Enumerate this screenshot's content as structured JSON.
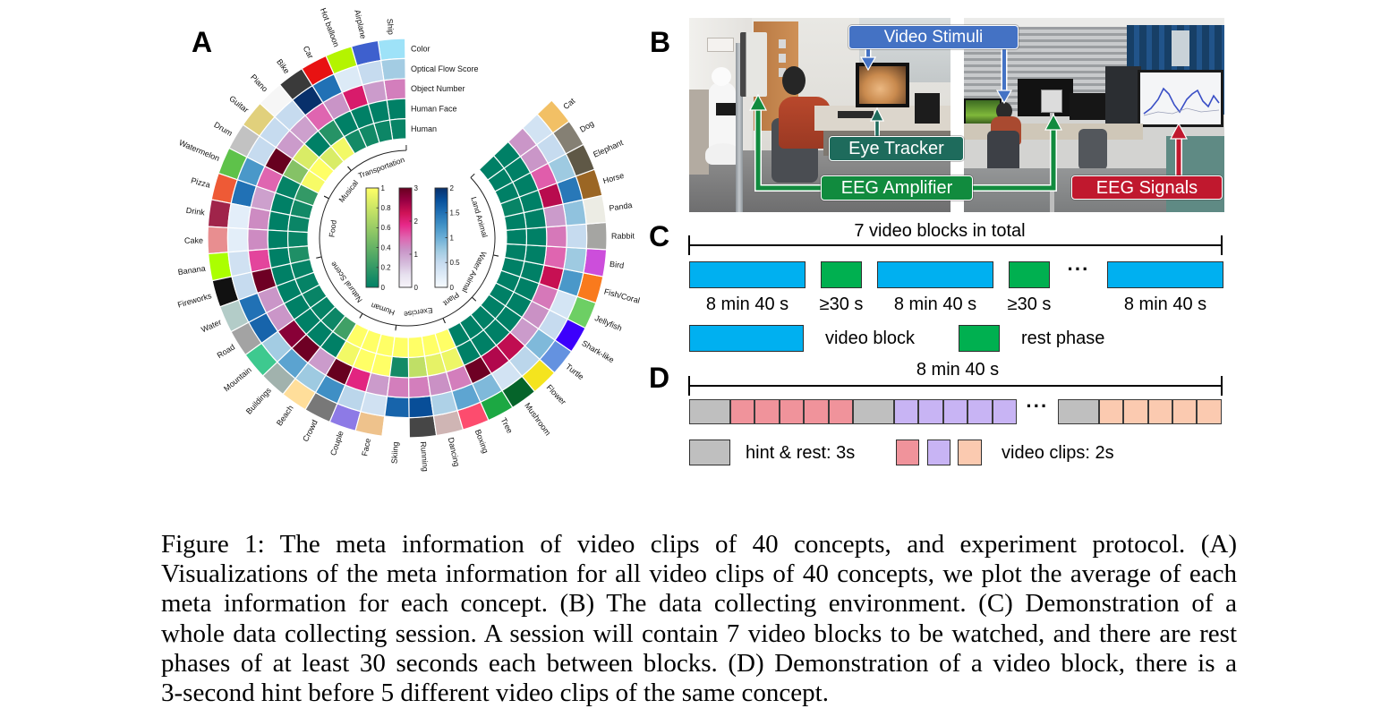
{
  "panel_labels": {
    "a": "A",
    "b": "B",
    "c": "C",
    "d": "D"
  },
  "chart_data": {
    "type": "heatmap",
    "layout": "circular",
    "title": "",
    "legend": "top-right",
    "rings": [
      {
        "key": "color",
        "label": "Color"
      },
      {
        "key": "optical_flow",
        "label": "Optical Flow Score",
        "colorbar": "blues"
      },
      {
        "key": "object_number",
        "label": "Object Number",
        "colorbar": "purd"
      },
      {
        "key": "human_face",
        "label": "Human Face",
        "colorbar": "summer"
      },
      {
        "key": "human",
        "label": "Human",
        "colorbar": "summer"
      }
    ],
    "categories": [
      "Transportation",
      "Musical",
      "Food",
      "Natural Scene",
      "Human",
      "Exercise",
      "Plant",
      "Water Animal",
      "Land Animal"
    ],
    "concepts": [
      {
        "name": "Ship",
        "category": "Transportation",
        "color": "#9ee2f8",
        "optical_flow": 0.72,
        "object_number": 1.3,
        "human_face": 0,
        "human": 0.03
      },
      {
        "name": "Airplane",
        "category": "Transportation",
        "color": "#3e60ce",
        "optical_flow": 0.5,
        "object_number": 1.05,
        "human_face": 0,
        "human": 0.05
      },
      {
        "name": "Hot balloon",
        "category": "Transportation",
        "color": "#b4f400",
        "optical_flow": 0.27,
        "object_number": 2.1,
        "human_face": 0,
        "human": 0.07
      },
      {
        "name": "Car",
        "category": "Transportation",
        "color": "#e81212",
        "optical_flow": 1.5,
        "object_number": 1.12,
        "human_face": 0,
        "human": 0.08
      },
      {
        "name": "Bike",
        "category": "Transportation",
        "color": "#3a3a3a",
        "optical_flow": 2.0,
        "object_number": 1.5,
        "human_face": 0.15,
        "human": 0.95
      },
      {
        "name": "Piano",
        "category": "Musical",
        "color": "#f6f6f6",
        "optical_flow": 0.5,
        "object_number": 1.0,
        "human_face": 0,
        "human": 0.85
      },
      {
        "name": "Guitar",
        "category": "Musical",
        "color": "#e1d07c",
        "optical_flow": 0.5,
        "object_number": 1.05,
        "human_face": 0.85,
        "human": 1.0
      },
      {
        "name": "Drum",
        "category": "Musical",
        "color": "#c2c2c2",
        "optical_flow": 0.5,
        "object_number": 3.0,
        "human_face": 0.52,
        "human": 0.97
      },
      {
        "name": "Watermelon",
        "category": "Food",
        "color": "#5ec24a",
        "optical_flow": 1.2,
        "object_number": 1.5,
        "human_face": 0.02,
        "human": 0.2
      },
      {
        "name": "Pizza",
        "category": "Food",
        "color": "#ee5a36",
        "optical_flow": 1.5,
        "object_number": 1.0,
        "human_face": 0,
        "human": 0.07
      },
      {
        "name": "Drink",
        "category": "Food",
        "color": "#a0244a",
        "optical_flow": 0.2,
        "object_number": 1.2,
        "human_face": 0,
        "human": 0.04
      },
      {
        "name": "Cake",
        "category": "Food",
        "color": "#e88e90",
        "optical_flow": 0.2,
        "object_number": 1.2,
        "human_face": 0,
        "human": 0.03
      },
      {
        "name": "Banana",
        "category": "Food",
        "color": "#abff00",
        "optical_flow": 0.4,
        "object_number": 1.7,
        "human_face": 0,
        "human": 0.12
      },
      {
        "name": "Fireworks",
        "category": "Natural Scene",
        "color": "#111111",
        "optical_flow": 0.5,
        "object_number": 2.95,
        "human_face": 0,
        "human": 0.02
      },
      {
        "name": "Water",
        "category": "Natural Scene",
        "color": "#b3ccc8",
        "optical_flow": 1.5,
        "object_number": 1.1,
        "human_face": 0,
        "human": 0.02
      },
      {
        "name": "Road",
        "category": "Natural Scene",
        "color": "#a3a3a3",
        "optical_flow": 1.6,
        "object_number": 1.1,
        "human_face": 0,
        "human": 0.03
      },
      {
        "name": "Mountain",
        "category": "Natural Scene",
        "color": "#3ec98f",
        "optical_flow": 0.72,
        "object_number": 2.75,
        "human_face": 0,
        "human": 0.02
      },
      {
        "name": "Buildings",
        "category": "Natural Scene",
        "color": "#a1b2ad",
        "optical_flow": 1.1,
        "object_number": 2.95,
        "human_face": 0,
        "human": 0.05
      },
      {
        "name": "Beach",
        "category": "Natural Scene",
        "color": "#ffde9a",
        "optical_flow": 0.75,
        "object_number": 1.05,
        "human_face": 0,
        "human": 0.25
      },
      {
        "name": "Crowd",
        "category": "Human",
        "color": "#787878",
        "optical_flow": 1.27,
        "object_number": 3.0,
        "human_face": 0.95,
        "human": 1.0
      },
      {
        "name": "Couple",
        "category": "Human",
        "color": "#8d7ae6",
        "optical_flow": 0.57,
        "object_number": 1.95,
        "human_face": 1.0,
        "human": 1.0
      },
      {
        "name": "Face",
        "category": "Human",
        "color": "#eec28c",
        "optical_flow": 0.4,
        "object_number": 1.05,
        "human_face": 1.0,
        "human": 1.0
      },
      {
        "name": "Skiing",
        "category": "Exercise",
        "color": "#ffffff",
        "optical_flow": 1.6,
        "object_number": 1.3,
        "human_face": 0.08,
        "human": 1.0
      },
      {
        "name": "Running",
        "category": "Exercise",
        "color": "#464646",
        "optical_flow": 1.77,
        "object_number": 1.3,
        "human_face": 0.75,
        "human": 1.0
      },
      {
        "name": "Dancing",
        "category": "Exercise",
        "color": "#cfb5b4",
        "optical_flow": 0.65,
        "object_number": 1.15,
        "human_face": 0.9,
        "human": 1.0
      },
      {
        "name": "Boxing",
        "category": "Exercise",
        "color": "#fd4c6e",
        "optical_flow": 1.08,
        "object_number": 1.3,
        "human_face": 0.93,
        "human": 1.0
      },
      {
        "name": "Tree",
        "category": "Plant",
        "color": "#1ca843",
        "optical_flow": 0.9,
        "object_number": 2.95,
        "human_face": 0,
        "human": 0
      },
      {
        "name": "Mushroom",
        "category": "Plant",
        "color": "#05642a",
        "optical_flow": 0.38,
        "object_number": 2.45,
        "human_face": 0,
        "human": 0
      },
      {
        "name": "Flower",
        "category": "Plant",
        "color": "#f4e41e",
        "optical_flow": 0.57,
        "object_number": 2.35,
        "human_face": 0,
        "human": 0
      },
      {
        "name": "Turtle",
        "category": "Water Animal",
        "color": "#6492e0",
        "optical_flow": 0.9,
        "object_number": 1.05,
        "human_face": 0,
        "human": 0
      },
      {
        "name": "Shark-like",
        "category": "Water Animal",
        "color": "#3c00fc",
        "optical_flow": 0.5,
        "object_number": 1.15,
        "human_face": 0,
        "human": 0
      },
      {
        "name": "Jellyfish",
        "category": "Water Animal",
        "color": "#6dcf64",
        "optical_flow": 0.35,
        "object_number": 1.35,
        "human_face": 0,
        "human": 0
      },
      {
        "name": "Fish/Coral",
        "category": "Water Animal",
        "color": "#f97a1d",
        "optical_flow": 1.2,
        "object_number": 2.3,
        "human_face": 0,
        "human": 0
      },
      {
        "name": "Bird",
        "category": "Land Animal",
        "color": "#cc4edb",
        "optical_flow": 0.75,
        "object_number": 1.5,
        "human_face": 0,
        "human": 0
      },
      {
        "name": "Rabbit",
        "category": "Land Animal",
        "color": "#a5a5a2",
        "optical_flow": 0.5,
        "object_number": 1.35,
        "human_face": 0,
        "human": 0
      },
      {
        "name": "Panda",
        "category": "Land Animal",
        "color": "#ecece4",
        "optical_flow": 0.82,
        "object_number": 1.05,
        "human_face": 0,
        "human": 0
      },
      {
        "name": "Horse",
        "category": "Land Animal",
        "color": "#9b6624",
        "optical_flow": 1.45,
        "object_number": 2.4,
        "human_face": 0,
        "human": 0.03
      },
      {
        "name": "Elephant",
        "category": "Land Animal",
        "color": "#5f5846",
        "optical_flow": 0.75,
        "object_number": 1.55,
        "human_face": 0,
        "human": 0
      },
      {
        "name": "Dog",
        "category": "Land Animal",
        "color": "#858074",
        "optical_flow": 0.5,
        "object_number": 1.1,
        "human_face": 0,
        "human": 0
      },
      {
        "name": "Cat",
        "category": "Land Animal",
        "color": "#f2c065",
        "optical_flow": 0.38,
        "object_number": 1.1,
        "human_face": 0,
        "human": 0
      }
    ],
    "colorbars": [
      {
        "id": "summer",
        "min": 0,
        "max": 1,
        "ticks": [
          "0",
          "0.2",
          "0.4",
          "0.6",
          "0.8",
          "1"
        ],
        "stops": [
          "#008066",
          "#ffff66"
        ]
      },
      {
        "id": "purd",
        "min": 0,
        "max": 3,
        "ticks": [
          "0",
          "1",
          "2",
          "3"
        ],
        "stops": [
          "#f7f4f9",
          "#e7e1ef",
          "#d4b9da",
          "#c994c7",
          "#df65b0",
          "#e7298a",
          "#ce1256",
          "#980043",
          "#67001f"
        ]
      },
      {
        "id": "blues",
        "min": 0,
        "max": 2,
        "ticks": [
          "0",
          "0.5",
          "1",
          "1.5",
          "2"
        ],
        "stops": [
          "#f7fbff",
          "#deebf7",
          "#c6dbef",
          "#9ecae1",
          "#6baed6",
          "#4292c6",
          "#2171b5",
          "#08519c",
          "#08306b"
        ]
      }
    ]
  },
  "setup": {
    "labels": {
      "video_stimuli": "Video Stimuli",
      "eye_tracker": "Eye Tracker",
      "eeg_amplifier": "EEG Amplifier",
      "eeg_signals": "EEG Signals"
    },
    "colors": {
      "video_stimuli": "#4472c4",
      "eye_tracker": "#1e6b5c",
      "eeg_amplifier": "#118b3e",
      "eeg_signals": "#c0182e"
    }
  },
  "session": {
    "title": "7 video blocks in total",
    "blocks": [
      {
        "type": "video",
        "label": "8 min 40 s"
      },
      {
        "type": "rest",
        "label": "≥30 s"
      },
      {
        "type": "video",
        "label": "8 min 40 s"
      },
      {
        "type": "rest",
        "label": "≥30 s"
      },
      {
        "type": "ellipsis"
      },
      {
        "type": "video",
        "label": "8 min 40 s"
      }
    ],
    "ellipsis": "···",
    "legend": {
      "video": "video block",
      "rest": "rest phase"
    },
    "colors": {
      "video": "#00b0f0",
      "rest": "#00b050"
    }
  },
  "block": {
    "title": "8 min 40 s",
    "segments": [
      {
        "type": "hint"
      },
      {
        "type": "clips",
        "group": "pink",
        "count": 5
      },
      {
        "type": "hint"
      },
      {
        "type": "clips",
        "group": "purple",
        "count": 5
      },
      {
        "type": "ellipsis"
      },
      {
        "type": "hint"
      },
      {
        "type": "clips",
        "group": "peach",
        "count": 5
      }
    ],
    "ellipsis": "···",
    "legend": {
      "hint": "hint & rest: 3s",
      "clips": "video clips: 2s"
    },
    "colors": {
      "hint": "#bfbfbf",
      "pink": "#f0939b",
      "purple": "#c8b4f4",
      "peach": "#fbcab0"
    }
  },
  "caption": {
    "lines": [
      "Figure 1: The meta information of video clips of 40 concepts, and experiment protocol. (A)",
      "Visualizations of the meta information for all video clips of 40 concepts, we plot the average of each",
      "meta information for each concept. (B) The data collecting environment. (C) Demonstration of a",
      "whole data collecting session. A session will contain 7 video blocks to be watched, and there are rest",
      "phases of at least 30 seconds each between blocks. (D) Demonstration of a video block, there is a",
      "3-second hint before 5 different video clips of the same concept."
    ]
  }
}
